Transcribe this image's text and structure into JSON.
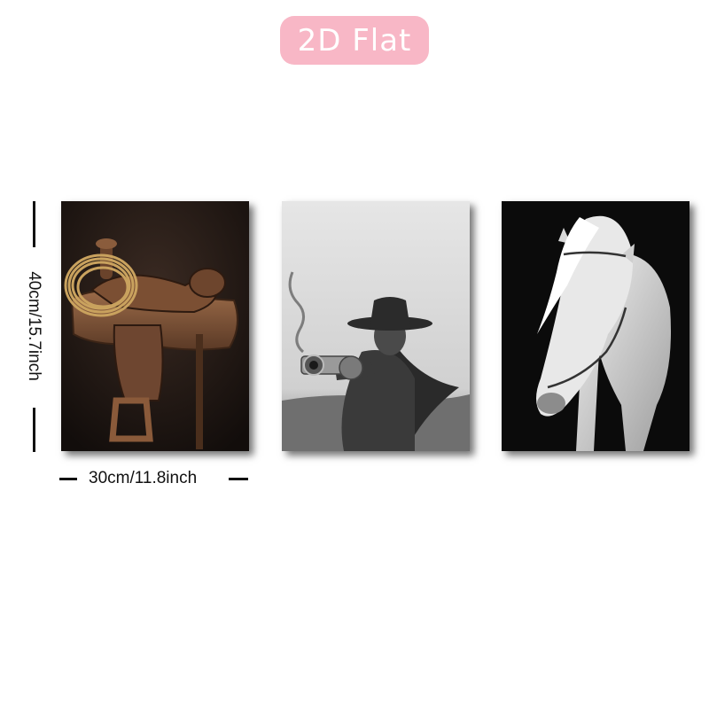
{
  "badge": {
    "label": "2D Flat",
    "color": "#f8b7c6"
  },
  "dimensions": {
    "height_label": "40cm/15.7inch",
    "width_label": "30cm/11.8inch"
  },
  "panels": [
    {
      "subject": "leather western saddle with lasso"
    },
    {
      "subject": "cowgirl in hat pointing revolver"
    },
    {
      "subject": "white horse with halter"
    }
  ]
}
